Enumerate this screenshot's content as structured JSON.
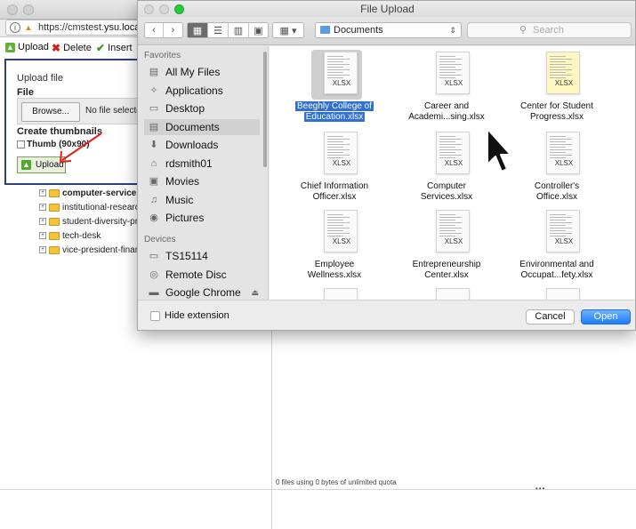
{
  "browser": {
    "url_prefix": "https://cmstest.",
    "url_host": "ysu.local",
    "toolbar": {
      "upload_label": "Upload",
      "delete_label": "Delete",
      "insert_label": "Insert"
    },
    "upload_panel": {
      "title": "Upload file",
      "file_label": "File",
      "browse_label": "Browse...",
      "no_file_text": "No file selected",
      "create_thumbnails_label": "Create thumbnails",
      "thumb_label": "Thumb (90x90)",
      "upload_button_label": "Upload"
    },
    "tree": [
      {
        "label": "computer-services",
        "bold": true
      },
      {
        "label": "institutional-research"
      },
      {
        "label": "student-diversity-programs"
      },
      {
        "label": "tech-desk"
      },
      {
        "label": "vice-president-finance"
      }
    ],
    "quota_text": "0 files using 0 bytes of unlimited quota"
  },
  "dialog": {
    "title": "File Upload",
    "location": "Documents",
    "search_placeholder": "Search",
    "sidebar": {
      "favorites_heading": "Favorites",
      "favorites": [
        {
          "label": "All My Files",
          "icon": "all-files-icon"
        },
        {
          "label": "Applications",
          "icon": "applications-icon"
        },
        {
          "label": "Desktop",
          "icon": "desktop-icon"
        },
        {
          "label": "Documents",
          "icon": "documents-icon",
          "selected": true
        },
        {
          "label": "Downloads",
          "icon": "downloads-icon"
        },
        {
          "label": "rdsmith01",
          "icon": "home-icon"
        },
        {
          "label": "Movies",
          "icon": "movies-icon"
        },
        {
          "label": "Music",
          "icon": "music-icon"
        },
        {
          "label": "Pictures",
          "icon": "pictures-icon"
        }
      ],
      "devices_heading": "Devices",
      "devices": [
        {
          "label": "TS15114",
          "icon": "computer-icon"
        },
        {
          "label": "Remote Disc",
          "icon": "disc-icon"
        },
        {
          "label": "Google Chrome",
          "icon": "drive-icon",
          "eject": true
        }
      ]
    },
    "files": [
      {
        "line1": "Beeghly College of",
        "line2": "Education.xlsx",
        "type": "XLSX",
        "selected": true
      },
      {
        "line1": "Career and",
        "line2": "Academi...sing.xlsx",
        "type": "XLSX"
      },
      {
        "line1": "Center for Student",
        "line2": "Progress.xlsx",
        "type": "XLSX",
        "yellow": true
      },
      {
        "line1": "Chief Information",
        "line2": "Officer.xlsx",
        "type": "XLSX"
      },
      {
        "line1": "Computer",
        "line2": "Services.xlsx",
        "type": "XLSX"
      },
      {
        "line1": "Controller's",
        "line2": "Office.xlsx",
        "type": "XLSX"
      },
      {
        "line1": "Employee",
        "line2": "Wellness.xlsx",
        "type": "XLSX"
      },
      {
        "line1": "Entrepreneurship",
        "line2": "Center.xlsx",
        "type": "XLSX"
      },
      {
        "line1": "Environmental and",
        "line2": "Occupat...fety.xlsx",
        "type": "XLSX"
      }
    ],
    "hide_extension_label": "Hide extension",
    "cancel_label": "Cancel",
    "open_label": "Open"
  }
}
